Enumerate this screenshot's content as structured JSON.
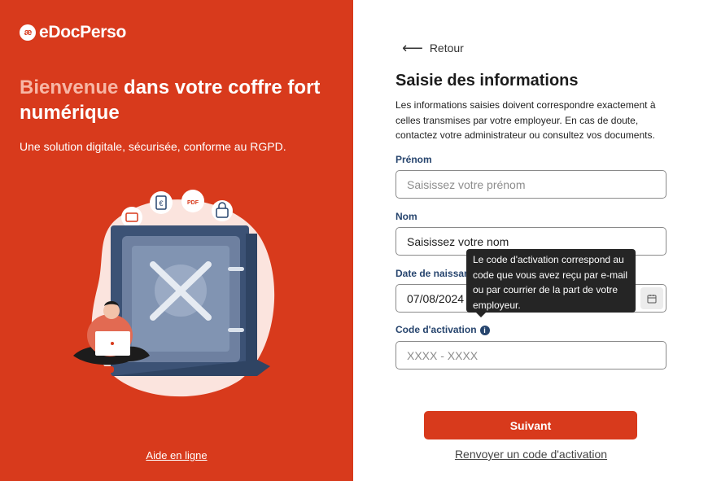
{
  "brand": {
    "logo_mark": "æ",
    "name": "eDocPerso"
  },
  "hero": {
    "title_accent": "Bienvenue",
    "title_rest": " dans votre coffre fort numérique",
    "subtitle": "Une solution digitale, sécurisée, conforme au RGPD.",
    "help_link": "Aide en ligne",
    "badges": [
      "€",
      "PDF"
    ]
  },
  "form": {
    "back_label": "Retour",
    "title": "Saisie des informations",
    "intro": "Les informations saisies doivent correspondre exactement à celles transmises par votre employeur. En cas de doute, contactez votre administrateur ou consultez vos documents.",
    "fields": {
      "firstname": {
        "label": "Prénom",
        "placeholder": "Saisissez votre prénom"
      },
      "lastname": {
        "label": "Nom",
        "value": "Saisissez votre nom"
      },
      "birthdate": {
        "label": "Date de naissance",
        "value": "07/08/2024"
      },
      "activation": {
        "label": "Code d'activation",
        "placeholder": "XXXX - XXXX",
        "info_glyph": "i"
      }
    },
    "tooltip": "Le code d'activation correspond au code que vous avez reçu par e-mail ou par courrier de la part de votre employeur.",
    "submit_label": "Suivant",
    "resend_label": "Renvoyer un code d'activation"
  },
  "colors": {
    "brand": "#d83a1c",
    "label": "#27456e",
    "accent_title": "#f7b6a5"
  }
}
